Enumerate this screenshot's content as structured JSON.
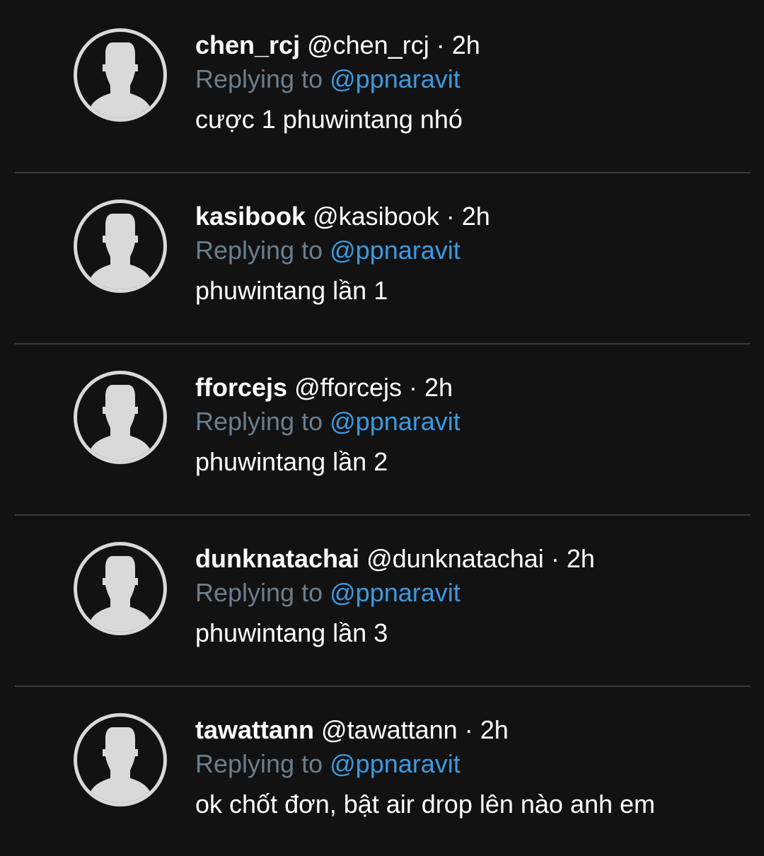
{
  "replies": [
    {
      "display_name": "chen_rcj",
      "handle": "@chen_rcj",
      "separator": "·",
      "time": "2h",
      "replying_prefix": "Replying to",
      "replying_to": "@ppnaravit",
      "text": "cược 1 phuwintang nhó"
    },
    {
      "display_name": "kasibook",
      "handle": "@kasibook",
      "separator": "·",
      "time": "2h",
      "replying_prefix": "Replying to",
      "replying_to": "@ppnaravit",
      "text": "phuwintang lần 1"
    },
    {
      "display_name": "fforcejs",
      "handle": "@fforcejs",
      "separator": "·",
      "time": "2h",
      "replying_prefix": "Replying to",
      "replying_to": "@ppnaravit",
      "text": "phuwintang lần 2"
    },
    {
      "display_name": "dunknatachai",
      "handle": "@dunknatachai",
      "separator": "·",
      "time": "2h",
      "replying_prefix": "Replying to",
      "replying_to": "@ppnaravit",
      "text": "phuwintang lần 3"
    },
    {
      "display_name": "tawattann",
      "handle": "@tawattann",
      "separator": "·",
      "time": "2h",
      "replying_prefix": "Replying to",
      "replying_to": "@ppnaravit",
      "text": "ok chốt đơn, bật air drop lên nào anh em"
    }
  ],
  "colors": {
    "background": "#121212",
    "text": "#ffffff",
    "muted": "#6b7e8e",
    "mention": "#3b9ae1",
    "divider": "#3a3a3a",
    "avatar": "#d9d9d9"
  },
  "icons": {
    "avatar": "default-profile-silhouette-icon"
  }
}
